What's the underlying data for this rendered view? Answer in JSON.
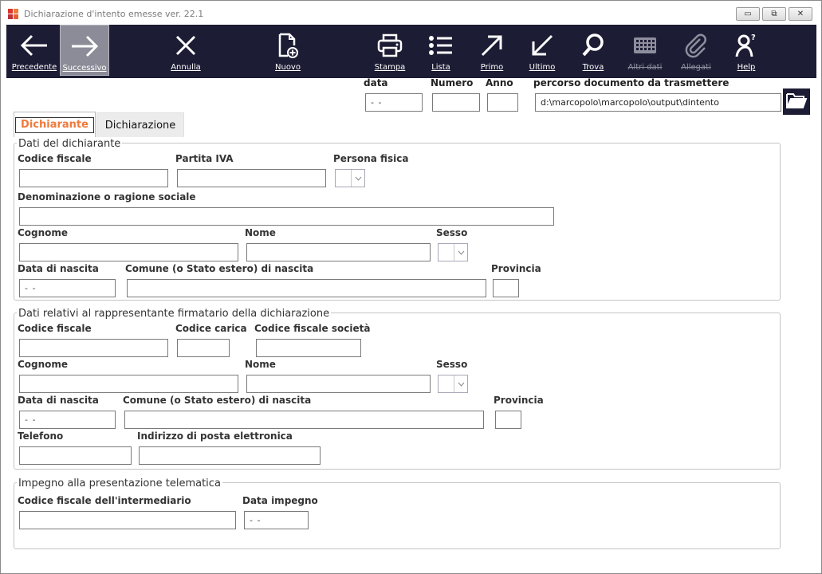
{
  "window": {
    "title": "Dichiarazione d'intento emesse  ver. 22.1",
    "buttons": {
      "minimize": "▭",
      "restore": "⧉",
      "close": "✕"
    }
  },
  "toolbar": {
    "items": [
      {
        "label": "Precedente",
        "icon": "arrow-left-icon",
        "state": "enabled"
      },
      {
        "label": "Successivo",
        "icon": "arrow-right-icon",
        "state": "active"
      },
      {
        "label": "Annulla",
        "icon": "close-icon",
        "state": "enabled"
      },
      {
        "label": "Nuovo",
        "icon": "new-document-icon",
        "state": "enabled"
      },
      {
        "label": "Stampa",
        "icon": "printer-icon",
        "state": "enabled"
      },
      {
        "label": "Lista",
        "icon": "list-icon",
        "state": "enabled"
      },
      {
        "label": "Primo",
        "icon": "arrow-up-right-icon",
        "state": "enabled"
      },
      {
        "label": "Ultimo",
        "icon": "arrow-down-left-icon",
        "state": "enabled"
      },
      {
        "label": "Trova",
        "icon": "search-icon",
        "state": "enabled"
      },
      {
        "label": "Altri dati",
        "icon": "grid-icon",
        "state": "disabled"
      },
      {
        "label": "Allegati",
        "icon": "paperclip-icon",
        "state": "disabled"
      },
      {
        "label": "Help",
        "icon": "help-icon",
        "state": "enabled"
      }
    ]
  },
  "header": {
    "data_label": "data",
    "data_value": "- -",
    "numero_label": "Numero",
    "numero_value": "",
    "anno_label": "Anno",
    "anno_value": "",
    "percorso_label": "percorso documento da trasmettere",
    "percorso_value": "d:\\marcopolo\\marcopolo\\output\\dintento"
  },
  "tabs": [
    {
      "label": "Dichiarante",
      "selected": true
    },
    {
      "label": "Dichiarazione",
      "selected": false
    }
  ],
  "dichiarante": {
    "title": "Dati del dichiarante",
    "codice_fiscale_label": "Codice fiscale",
    "codice_fiscale_value": "",
    "partita_iva_label": "Partita IVA",
    "partita_iva_value": "",
    "persona_fisica_label": "Persona fisica",
    "persona_fisica_value": "",
    "denominazione_label": "Denominazione o ragione sociale",
    "denominazione_value": "",
    "cognome_label": "Cognome",
    "cognome_value": "",
    "nome_label": "Nome",
    "nome_value": "",
    "sesso_label": "Sesso",
    "sesso_value": "",
    "data_nascita_label": "Data di nascita",
    "data_nascita_value": "- -",
    "comune_label": "Comune (o Stato estero) di nascita",
    "comune_value": "",
    "provincia_label": "Provincia",
    "provincia_value": ""
  },
  "rappresentante": {
    "title": "Dati relativi al rappresentante firmatario della dichiarazione",
    "codice_fiscale_label": "Codice fiscale",
    "codice_fiscale_value": "",
    "codice_carica_label": "Codice carica",
    "codice_carica_value": "",
    "cf_societa_label": "Codice fiscale società",
    "cf_societa_value": "",
    "cognome_label": "Cognome",
    "cognome_value": "",
    "nome_label": "Nome",
    "nome_value": "",
    "sesso_label": "Sesso",
    "sesso_value": "",
    "data_nascita_label": "Data di nascita",
    "data_nascita_value": "- -",
    "comune_label": "Comune (o Stato estero) di nascita",
    "comune_value": "",
    "provincia_label": "Provincia",
    "provincia_value": "",
    "telefono_label": "Telefono",
    "telefono_value": "",
    "email_label": "Indirizzo di posta elettronica",
    "email_value": ""
  },
  "impegno": {
    "title": "Impegno alla presentazione telematica",
    "cf_intermediario_label": "Codice fiscale dell'intermediario",
    "cf_intermediario_value": "",
    "data_impegno_label": "Data impegno",
    "data_impegno_value": "- -"
  },
  "colors": {
    "toolbar_bg": "#1c1c34",
    "selected_tab_text": "#f07a3c"
  }
}
